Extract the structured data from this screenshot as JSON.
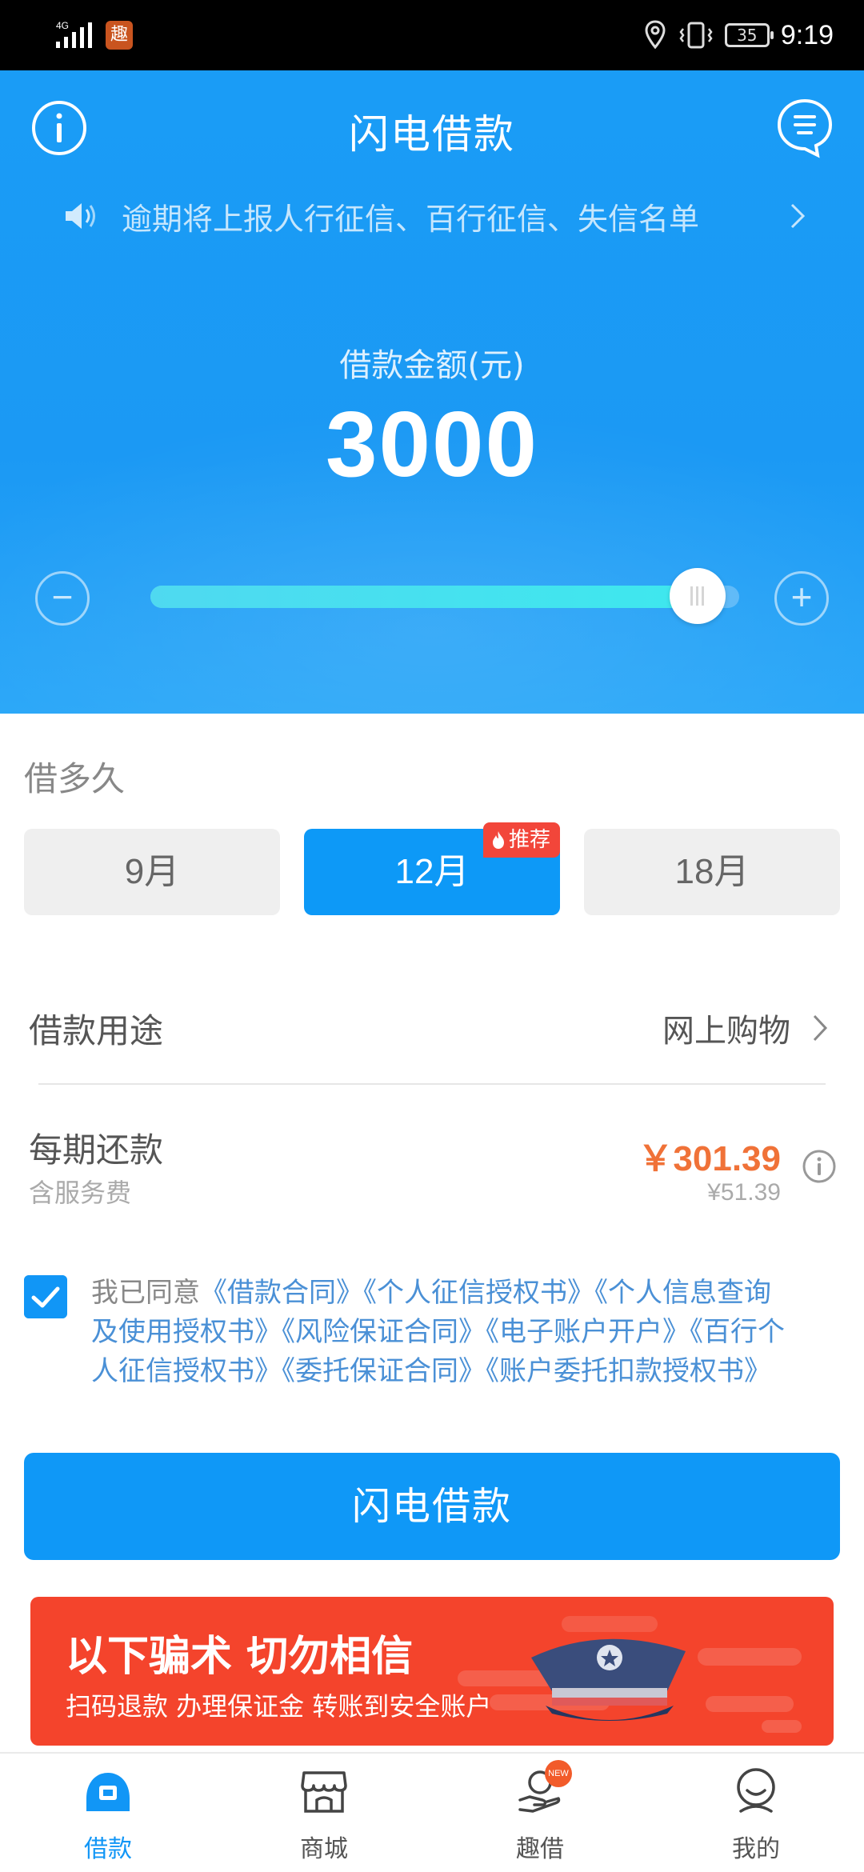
{
  "status_bar": {
    "network": "4G",
    "app_badge": "趣",
    "battery": "35",
    "time": "9:19"
  },
  "header": {
    "title": "闪电借款",
    "notice": "逾期将上报人行征信、百行征信、失信名单",
    "amount_label": "借款金额(元)",
    "amount_value": "3000",
    "minus_symbol": "−",
    "plus_symbol": "+",
    "slider_fraction": 0.93
  },
  "term": {
    "label": "借多久",
    "options": [
      {
        "label": "9月",
        "selected": false
      },
      {
        "label": "12月",
        "selected": true,
        "badge": "推荐"
      },
      {
        "label": "18月",
        "selected": false
      }
    ]
  },
  "purpose": {
    "label": "借款用途",
    "value": "网上购物"
  },
  "repayment": {
    "label": "每期还款",
    "sub_label": "含服务费",
    "value": "￥301.39",
    "sub_value": "¥51.39"
  },
  "agreement": {
    "checked": true,
    "prefix": "我已同意",
    "documents": "《借款合同》《个人征信授权书》《个人信息查询及使用授权书》《风险保证合同》《电子账户开户》《百行个人征信授权书》《委托保证合同》《账户委托扣款授权书》"
  },
  "submit": {
    "label": "闪电借款"
  },
  "banner": {
    "title": "以下骗术 切勿相信",
    "subtitle": "扫码退款 办理保证金 转账到安全账户"
  },
  "tabbar": {
    "items": [
      {
        "label": "借款",
        "icon": "loan-icon",
        "active": true
      },
      {
        "label": "商城",
        "icon": "store-icon",
        "active": false
      },
      {
        "label": "趣借",
        "icon": "hand-coin-icon",
        "active": false,
        "badge": "NEW"
      },
      {
        "label": "我的",
        "icon": "profile-icon",
        "active": false
      }
    ]
  },
  "colors": {
    "primary": "#0f98f7",
    "accent_orange": "#f07238",
    "banner_red": "#f4442c",
    "badge_red": "#f2463a"
  }
}
